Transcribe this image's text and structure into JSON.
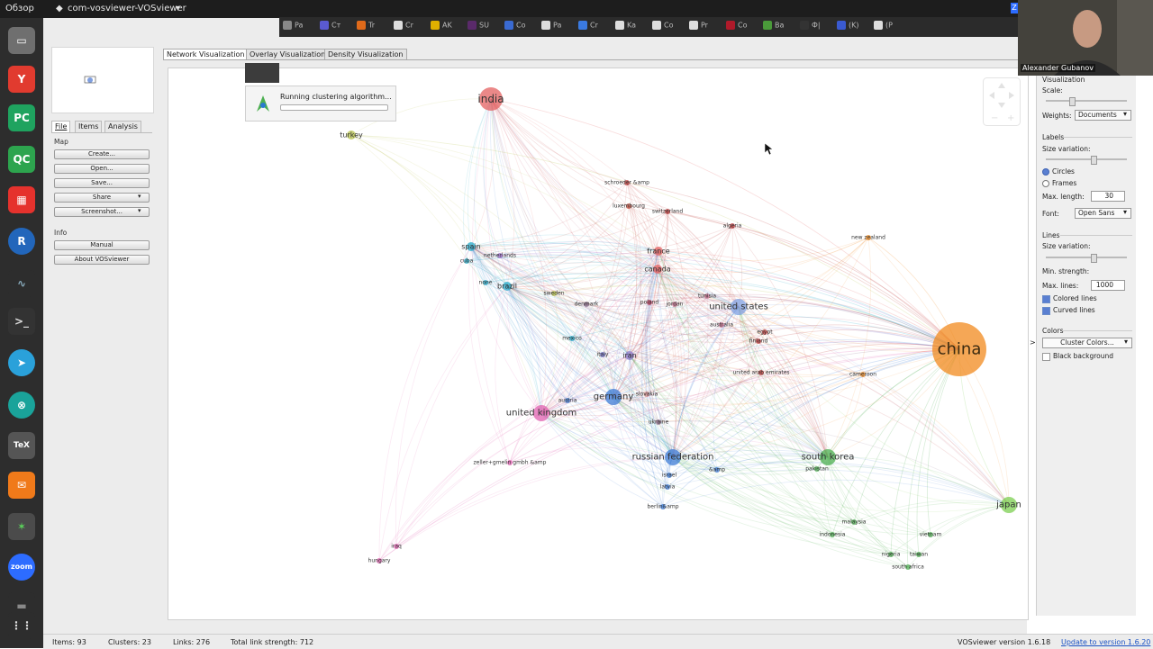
{
  "topbar": {
    "overview": "Обзор",
    "app_name": "com-vosviewer-VOSviewer"
  },
  "browser_tabs": [
    {
      "label": "Pa",
      "color": "#888"
    },
    {
      "label": "Ст",
      "color": "#5a5ad1"
    },
    {
      "label": "Tr",
      "color": "#e06a1a"
    },
    {
      "label": "Cr",
      "color": "#ddd"
    },
    {
      "label": "AK",
      "color": "#e0b000"
    },
    {
      "label": "SU",
      "color": "#5a2a6a"
    },
    {
      "label": "Co",
      "color": "#3a6ad1"
    },
    {
      "label": "Pa",
      "color": "#ddd"
    },
    {
      "label": "Cr",
      "color": "#3a7ae1"
    },
    {
      "label": "Ka",
      "color": "#ddd"
    },
    {
      "label": "Co",
      "color": "#ddd"
    },
    {
      "label": "Pr",
      "color": "#ddd"
    },
    {
      "label": "Co",
      "color": "#b01a2a"
    },
    {
      "label": "Ва",
      "color": "#4a9a3a"
    },
    {
      "label": "Ф|",
      "color": "#333"
    },
    {
      "label": "(K)",
      "color": "#3a5ad1"
    },
    {
      "label": "(P",
      "color": "#ddd"
    }
  ],
  "webcam": {
    "name": "Alexander Gubanov"
  },
  "left_panel": {
    "tabs": [
      "File",
      "Items",
      "Analysis"
    ],
    "map_header": "Map",
    "buttons": [
      "Create...",
      "Open...",
      "Save...",
      "Share",
      "Screenshot..."
    ],
    "info_header": "Info",
    "info_buttons": [
      "Manual",
      "About VOSviewer"
    ]
  },
  "view_tabs": [
    "Network Visualization",
    "Overlay Visualization",
    "Density Visualization"
  ],
  "popup": {
    "message": "Running clustering algorithm..."
  },
  "right_panel": {
    "visualization_header": "Visualization",
    "scale_label": "Scale:",
    "weights_label": "Weights:",
    "weights_value": "Documents",
    "labels_header": "Labels",
    "size_variation_label": "Size variation:",
    "circles_label": "Circles",
    "frames_label": "Frames",
    "max_length_label": "Max. length:",
    "max_length_value": "30",
    "font_label": "Font:",
    "font_value": "Open Sans",
    "lines_header": "Lines",
    "lines_size_variation_label": "Size variation:",
    "min_strength_label": "Min. strength:",
    "max_lines_label": "Max. lines:",
    "max_lines_value": "1000",
    "colored_lines_label": "Colored lines",
    "curved_lines_label": "Curved lines",
    "colors_header": "Colors",
    "cluster_colors_button": "Cluster Colors...",
    "black_background_label": "Black background"
  },
  "status": {
    "items": "Items:  93",
    "clusters": "Clusters:  23",
    "links": "Links:  276",
    "strength": "Total link strength:  712",
    "version": "VOSviewer version 1.6.18",
    "update_link": "Update to version 1.6.20"
  },
  "nodes": [
    {
      "label": "china",
      "color": "#f28a1e",
      "size": "xl"
    },
    {
      "label": "india",
      "color": "#e46060",
      "size": "l"
    },
    {
      "label": "united states",
      "color": "#7f9fe0",
      "size": "m"
    },
    {
      "label": "germany",
      "color": "#3c7bd6",
      "size": "m"
    },
    {
      "label": "russian federation",
      "color": "#3c7bd6",
      "size": "m"
    },
    {
      "label": "united kingdom",
      "color": "#e060b0",
      "size": "m"
    },
    {
      "label": "south korea",
      "color": "#4caf50",
      "size": "m"
    },
    {
      "label": "japan",
      "color": "#7ccf50",
      "size": "m"
    },
    {
      "label": "iran",
      "color": "#8a7acb",
      "size": "s"
    },
    {
      "label": "spain",
      "color": "#25a9c9",
      "size": "s"
    },
    {
      "label": "brazil",
      "color": "#25a9c9",
      "size": "s"
    },
    {
      "label": "canada",
      "color": "#e46060",
      "size": "s"
    },
    {
      "label": "france",
      "color": "#e46060",
      "size": "s"
    },
    {
      "label": "turkey",
      "color": "#b6c24a",
      "size": "s"
    },
    {
      "label": "luxembourg",
      "color": "#c04a3a",
      "size": "xs"
    },
    {
      "label": "poland",
      "color": "#c03a5a",
      "size": "xs"
    },
    {
      "label": "sweden",
      "color": "#b6c24a",
      "size": "xs"
    },
    {
      "label": "netherlands",
      "color": "#9a6acb",
      "size": "xs"
    },
    {
      "label": "australia",
      "color": "#c06a8a",
      "size": "xs"
    },
    {
      "label": "finland",
      "color": "#c03a3a",
      "size": "xs"
    },
    {
      "label": "mexico",
      "color": "#25a9c9",
      "size": "xs"
    },
    {
      "label": "italy",
      "color": "#6a6ac0",
      "size": "xs"
    },
    {
      "label": "slovakia",
      "color": "#d08a8a",
      "size": "xs"
    },
    {
      "label": "ukraine",
      "color": "#8a6a8a",
      "size": "xs"
    },
    {
      "label": "&amp",
      "color": "#3c7bd6",
      "size": "xs"
    },
    {
      "label": "pakistan",
      "color": "#4caf50",
      "size": "xs"
    },
    {
      "label": "malaysia",
      "color": "#4caf50",
      "size": "xs"
    },
    {
      "label": "indonesia",
      "color": "#4caf50",
      "size": "xs"
    },
    {
      "label": "vietnam",
      "color": "#4caf50",
      "size": "xs"
    },
    {
      "label": "taiwan",
      "color": "#4caf50",
      "size": "xs"
    },
    {
      "label": "south africa",
      "color": "#4caf50",
      "size": "xs"
    },
    {
      "label": "nigeria",
      "color": "#4caf50",
      "size": "xs"
    },
    {
      "label": "iraq",
      "color": "#e060b0",
      "size": "xs"
    },
    {
      "label": "hungary",
      "color": "#e060b0",
      "size": "xs"
    },
    {
      "label": "denmark",
      "color": "#8a6a8a",
      "size": "xs"
    },
    {
      "label": "jordan",
      "color": "#c06a8a",
      "size": "xs"
    },
    {
      "label": "tunisia",
      "color": "#c06a8a",
      "size": "xs"
    },
    {
      "label": "egypt",
      "color": "#c03a3a",
      "size": "xs"
    },
    {
      "label": "algeria",
      "color": "#c03a3a",
      "size": "xs"
    },
    {
      "label": "switzerland",
      "color": "#c03a3a",
      "size": "xs"
    },
    {
      "label": "schroeder &amp",
      "color": "#c03a3a",
      "size": "xs"
    },
    {
      "label": "new zealand",
      "color": "#f28a1e",
      "size": "xs"
    },
    {
      "label": "cameroon",
      "color": "#f28a1e",
      "size": "xs"
    },
    {
      "label": "united arab emirates",
      "color": "#c03a3a",
      "size": "xs"
    },
    {
      "label": "austria",
      "color": "#3c7bd6",
      "size": "xs"
    },
    {
      "label": "latvia",
      "color": "#3c7bd6",
      "size": "xs"
    },
    {
      "label": "israel",
      "color": "#3c7bd6",
      "size": "xs"
    },
    {
      "label": "berlin&amp",
      "color": "#3c7bd6",
      "size": "xs"
    },
    {
      "label": "zeller+gmelin gmbh &amp",
      "color": "#e060b0",
      "size": "xs"
    },
    {
      "label": "none",
      "color": "#25a9c9",
      "size": "xs"
    },
    {
      "label": "cuba",
      "color": "#25a9c9",
      "size": "xs"
    }
  ]
}
